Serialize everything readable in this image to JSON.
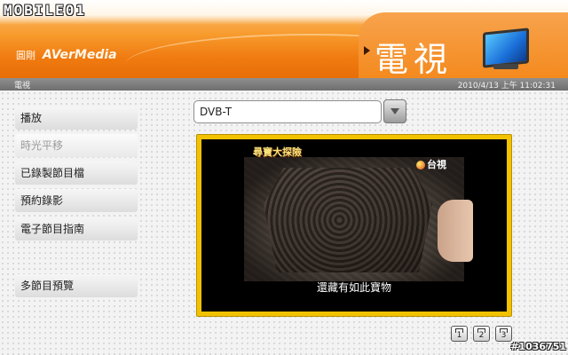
{
  "watermark": {
    "site_logo": "MOBILE01",
    "image_id": "#1036751"
  },
  "brand": {
    "cn": "圓剛",
    "en": "AVerMedia"
  },
  "header": {
    "title": "電視"
  },
  "statusbar": {
    "section": "電視",
    "datetime": "2010/4/13 上午 11:02:31"
  },
  "menu": {
    "items": [
      {
        "label": "播放",
        "enabled": true
      },
      {
        "label": "時光平移",
        "enabled": false
      },
      {
        "label": "已錄製節目檔",
        "enabled": true
      },
      {
        "label": "預約錄影",
        "enabled": true
      },
      {
        "label": "電子節目指南",
        "enabled": true
      },
      {
        "label": "多節目預覽",
        "enabled": true
      }
    ]
  },
  "source_select": {
    "value": "DVB-T"
  },
  "video": {
    "show_logo": "尋寶大探險",
    "channel_logo": "台視",
    "subtitle": "還藏有如此寶物"
  },
  "capture_buttons": [
    {
      "label": "1"
    },
    {
      "label": "2"
    },
    {
      "label": "3"
    }
  ],
  "colors": {
    "header_orange": "#f79a2c",
    "video_frame": "#f2c200"
  }
}
